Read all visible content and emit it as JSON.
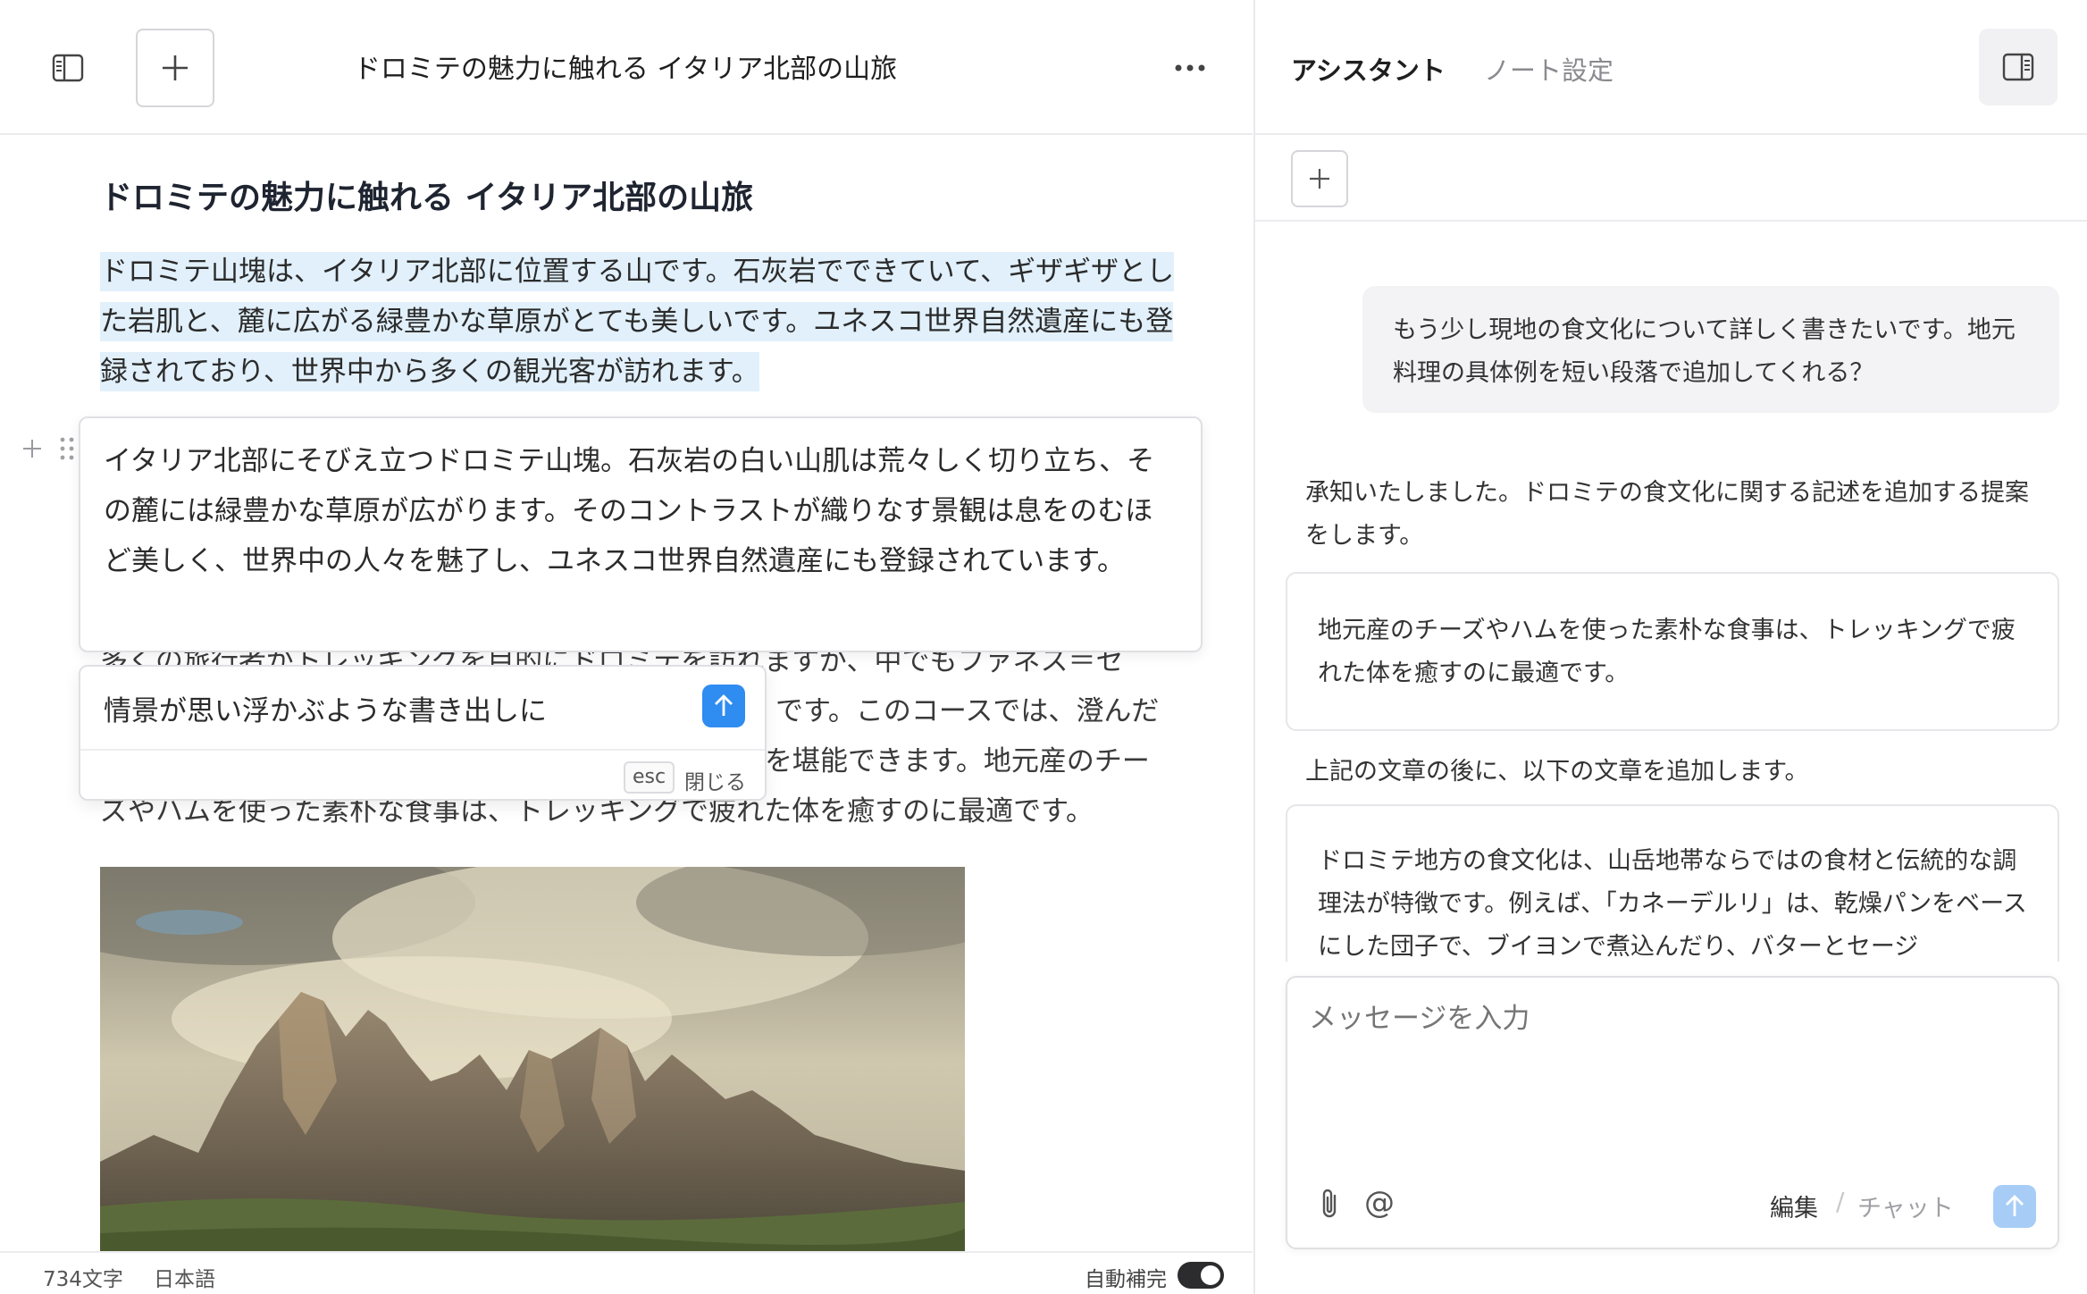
{
  "editor_header": {
    "title": "ドロミテの魅力に触れる イタリア北部の山旅"
  },
  "document": {
    "heading": "ドロミテの魅力に触れる イタリア北部の山旅",
    "paragraph1": "ドロミテ山塊は、イタリア北部に位置する山です。石灰岩でできていて、ギザギザとした岩肌と、麓に広がる緑豊かな草原がとても美しいです。ユネスコ世界自然遺産にも登録されており、世界中から多くの観光客が訪れます。",
    "suggestion": "イタリア北部にそびえ立つドロミテ山塊。石灰岩の白い山肌は荒々しく切り立ち、その麓には緑豊かな草原が広がります。そのコントラストが織りなす景観は息をのむほど美しく、世界中の人々を魅了し、ユネスコ世界自然遺産にも登録されています。",
    "paragraph3_line1": "多くの旅行者がトレッキングを目的にドロミテを訪れますが、中でもファネス＝セ",
    "paragraph3_line2": "です。このコースでは、澄んだ",
    "paragraph3_line3": "を堪能できます。地元産のチー",
    "paragraph3_line4": "ズやハムを使った素朴な食事は、トレッキングで疲れた体を癒すのに最適です。"
  },
  "prompt": {
    "input_value": "情景が思い浮かぶような書き出しに",
    "esc_key": "esc",
    "close_label": "閉じる"
  },
  "status_bar": {
    "word_count": "734文字",
    "language": "日本語",
    "autocomplete_label": "自動補完",
    "autocomplete_on": true
  },
  "assistant": {
    "tabs": [
      "アシスタント",
      "ノート設定"
    ],
    "user_message": "もう少し現地の食文化について詳しく書きたいです。地元料理の具体例を短い段落で追加してくれる？",
    "reply_intro": "承知いたしました。ドロミテの食文化に関する記述を追加する提案をします。",
    "quoted_text": "地元産のチーズやハムを使った素朴な食事は、トレッキングで疲れた体を癒すのに最適です。",
    "reply_after": "上記の文章の後に、以下の文章を追加します。",
    "proposed_text": "ドロミテ地方の食文化は、山岳地帯ならではの食材と伝統的な調理法が特徴です。例えば、「カネーデルリ」は、乾燥パンをベースにした団子で、ブイヨンで煮込んだり、バターとセージ"
  },
  "composer": {
    "placeholder": "メッセージを入力",
    "mode_edit": "編集",
    "mode_separator": "/",
    "mode_chat": "チャット"
  },
  "colors": {
    "accent": "#2f8cf0",
    "highlight": "#e1f0fb",
    "send_disabled": "#a7cdf6"
  }
}
